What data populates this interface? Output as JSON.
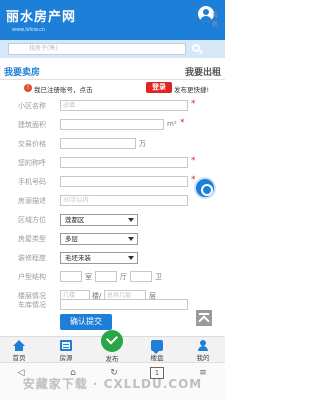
{
  "header": {
    "logo": "丽水房产网",
    "logo_sub": "www.lsfcw.cn",
    "member_label": "会员"
  },
  "search": {
    "placeholder": "找房子(售)"
  },
  "tabs": {
    "sell": "我要卖房",
    "rent": "我要出租"
  },
  "notice": {
    "text_before": "我已注册账号，点击",
    "login_button": "登录",
    "text_after": "发布更快捷!"
  },
  "form": {
    "community": {
      "label": "小区名称",
      "placeholder": "必填"
    },
    "area": {
      "label": "建筑面积",
      "unit": "m²"
    },
    "price": {
      "label": "交易价格",
      "unit": "万"
    },
    "name": {
      "label": "您的称呼"
    },
    "phone": {
      "label": "手机号码"
    },
    "desc": {
      "label": "房源描述",
      "placeholder": "30字以内"
    },
    "district": {
      "label": "区域方位",
      "value": "莲都区"
    },
    "house_type": {
      "label": "房屋类型",
      "value": "多层"
    },
    "decoration": {
      "label": "装修程度",
      "value": "毛坯未装"
    },
    "layout": {
      "label": "户型结构",
      "room": "室",
      "hall": "厅",
      "bath": "卫"
    },
    "floor": {
      "label": "楼层情况",
      "floor_placeholder": "几楼",
      "floor_unit": "楼/",
      "total_placeholder": "总共几层",
      "total_unit": "层"
    },
    "garage": {
      "label": "车库情况"
    },
    "submit": "确认提交"
  },
  "bottom_nav": {
    "home": "首页",
    "listings": "房源",
    "publish": "发布",
    "forum": "楼盘",
    "mine": "我的"
  },
  "browser": {
    "back": "◁",
    "home_icon": "⌂",
    "refresh": "↻",
    "tabs_count": "1",
    "menu": "≡"
  },
  "watermark": "安藏家下载 · CXLLDU.COM",
  "colors": {
    "primary": "#1e7fd8",
    "required": "#e02424",
    "publish": "#28a745"
  }
}
